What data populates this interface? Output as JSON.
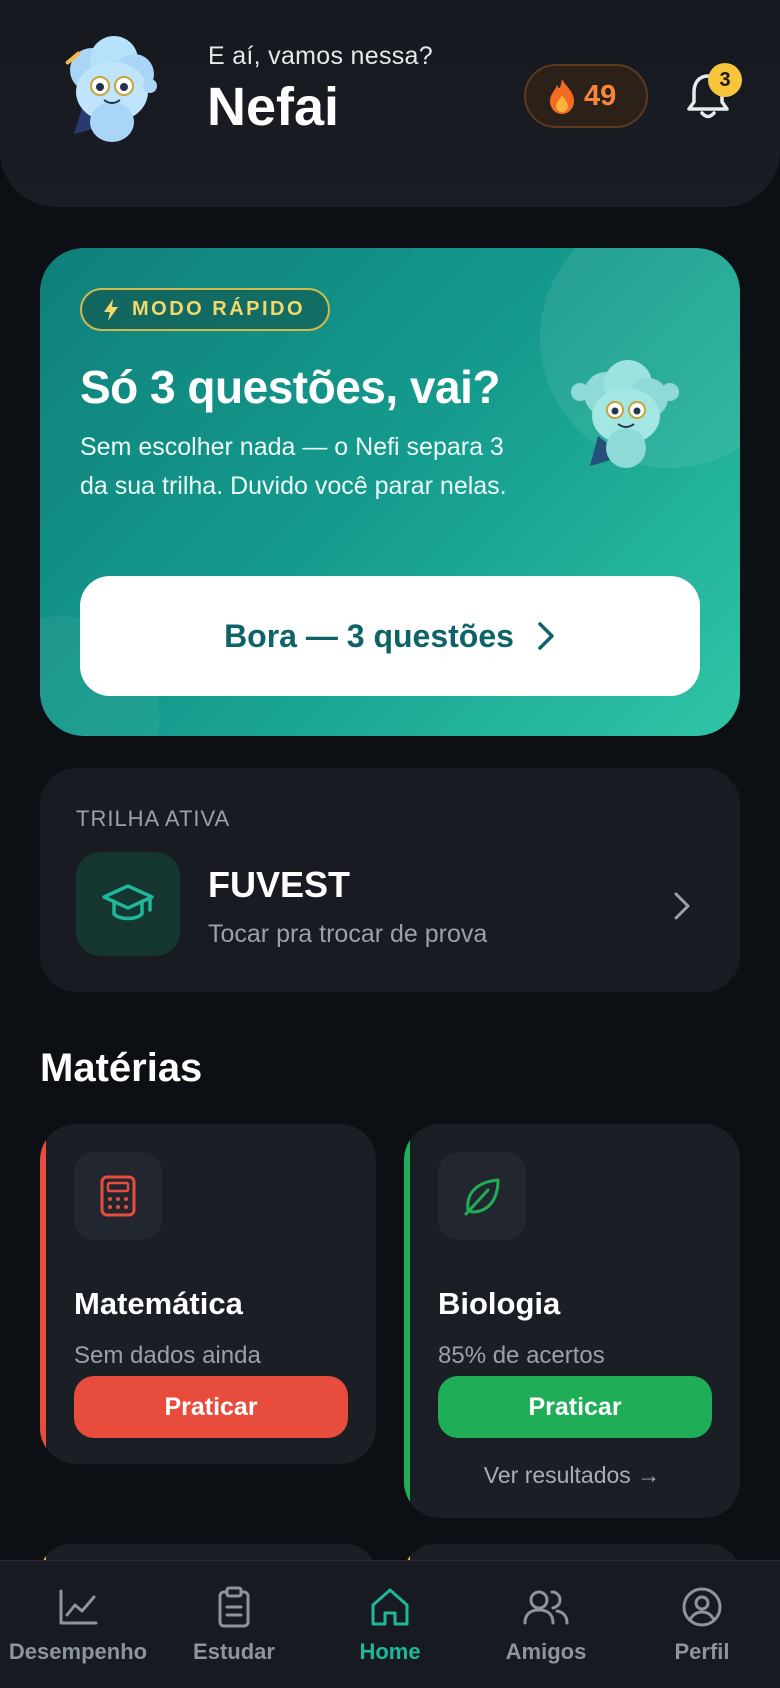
{
  "header": {
    "greeting": "E aí, vamos nessa?",
    "name": "Nefai",
    "streak": "49",
    "notifications": "3"
  },
  "quick": {
    "badge": "MODO RÁPIDO",
    "title": "Só 3 questões, vai?",
    "description": "Sem escolher nada — o Nefi separa 3 da sua trilha. Duvido você parar nelas.",
    "button": "Bora — 3 questões"
  },
  "trilha": {
    "label": "TRILHA ATIVA",
    "name": "FUVEST",
    "subtitle": "Tocar pra trocar de prova"
  },
  "subjects_section": {
    "title": "Matérias",
    "items": [
      {
        "name": "Matemática",
        "status": "Sem dados ainda",
        "button": "Praticar",
        "color": "#e84c3d"
      },
      {
        "name": "Biologia",
        "status": "85% de acertos",
        "button": "Praticar",
        "link": "Ver resultados →",
        "color": "#1fae57"
      }
    ]
  },
  "nav": {
    "items": [
      {
        "label": "Desempenho",
        "icon": "chart-line-icon"
      },
      {
        "label": "Estudar",
        "icon": "clipboard-icon"
      },
      {
        "label": "Home",
        "icon": "home-icon",
        "active": true
      },
      {
        "label": "Amigos",
        "icon": "users-icon"
      },
      {
        "label": "Perfil",
        "icon": "user-circle-icon"
      }
    ]
  },
  "colors": {
    "accent": "#1fb79a",
    "streak": "#f7863a",
    "badge": "#f7c53a"
  }
}
